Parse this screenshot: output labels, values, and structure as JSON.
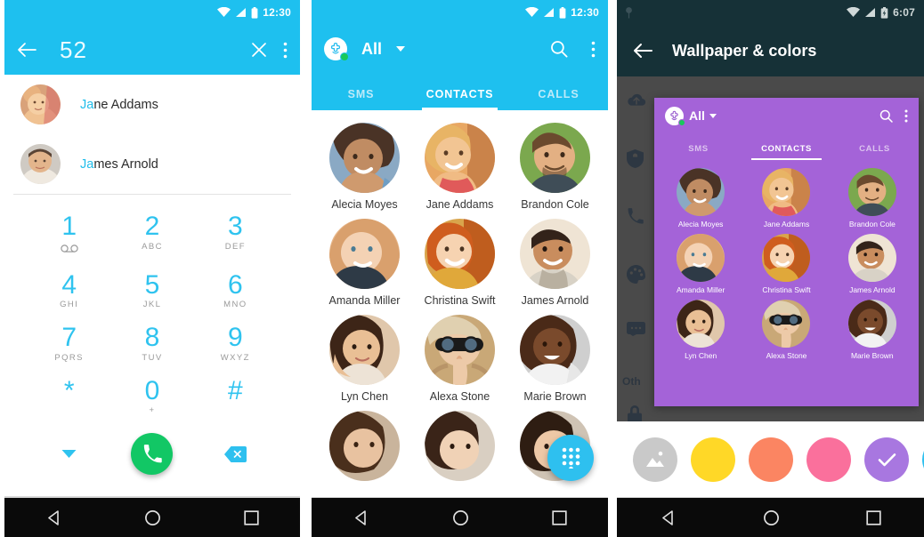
{
  "panels": {
    "dialer": {
      "statusbar": {
        "time": "12:30",
        "icons": [
          "wifi-icon",
          "signal-icon",
          "battery-icon"
        ]
      },
      "toolbar": {
        "back_icon": "back-arrow-icon",
        "number": "52",
        "clear_icon": "close-icon",
        "overflow_icon": "more-vert-icon"
      },
      "suggestions": [
        {
          "name_match": "Ja",
          "name_rest": "ne Addams"
        },
        {
          "name_match": "Ja",
          "name_rest": "mes Arnold"
        }
      ],
      "keypad": [
        [
          {
            "digit": "1",
            "sub": ""
          },
          {
            "digit": "2",
            "sub": "ABC"
          },
          {
            "digit": "3",
            "sub": "DEF"
          }
        ],
        [
          {
            "digit": "4",
            "sub": "GHI"
          },
          {
            "digit": "5",
            "sub": "JKL"
          },
          {
            "digit": "6",
            "sub": "MNO"
          }
        ],
        [
          {
            "digit": "7",
            "sub": "PQRS"
          },
          {
            "digit": "8",
            "sub": "TUV"
          },
          {
            "digit": "9",
            "sub": "WXYZ"
          }
        ],
        [
          {
            "digit": "*",
            "sub": ""
          },
          {
            "digit": "0",
            "sub": "+"
          },
          {
            "digit": "#",
            "sub": ""
          }
        ]
      ],
      "voicemail_icon": "voicemail-icon",
      "actions": {
        "collapse_icon": "chevron-down-icon",
        "call_icon": "phone-call-icon",
        "backspace_icon": "backspace-icon"
      },
      "colors": {
        "accent": "#1ec0ef",
        "call_green": "#12c765",
        "digit": "#2fc3ef"
      }
    },
    "contacts": {
      "statusbar": {
        "time": "12:30",
        "icons": [
          "wifi-icon",
          "signal-icon",
          "battery-icon"
        ]
      },
      "toolbar": {
        "app_icon": "app-logo-icon",
        "filter_label": "All",
        "search_icon": "search-icon",
        "overflow_icon": "more-vert-icon"
      },
      "tabs": [
        {
          "label": "SMS",
          "active": false
        },
        {
          "label": "CONTACTS",
          "active": true
        },
        {
          "label": "CALLS",
          "active": false
        }
      ],
      "grid": [
        [
          "Alecia Moyes",
          "Jane Addams",
          "Brandon Cole"
        ],
        [
          "Amanda Miller",
          "Christina Swift",
          "James Arnold"
        ],
        [
          "Lyn Chen",
          "Alexa Stone",
          "Marie Brown"
        ]
      ],
      "fab_icon": "dialpad-icon",
      "colors": {
        "accent": "#1ec0ef",
        "fab": "#2ec0ef"
      }
    },
    "wallpaper": {
      "statusbar": {
        "time": "6:07",
        "icons": [
          "notification-icon",
          "wifi-icon",
          "signal-icon",
          "battery-charging-icon"
        ]
      },
      "toolbar": {
        "back_icon": "back-arrow-icon",
        "title": "Wallpaper & colors"
      },
      "settings_behind": {
        "icons": [
          "cloud-upload-icon",
          "shield-icon",
          "phone-icon",
          "palette-icon",
          "chat-icon",
          "lock-icon"
        ],
        "section_label": "Oth"
      },
      "preview": {
        "toolbar": {
          "app_icon": "app-logo-icon",
          "filter_label": "All",
          "search_icon": "search-icon",
          "overflow_icon": "more-vert-icon"
        },
        "tabs": [
          {
            "label": "SMS",
            "active": false
          },
          {
            "label": "CONTACTS",
            "active": true
          },
          {
            "label": "CALLS",
            "active": false
          }
        ],
        "grid": [
          [
            "Alecia Moyes",
            "Jane Addams",
            "Brandon Cole"
          ],
          [
            "Amanda Miller",
            "Christina Swift",
            "James Arnold"
          ],
          [
            "Lyn Chen",
            "Alexa Stone",
            "Marie Brown"
          ]
        ],
        "theme_color": "#a463d8"
      },
      "swatches": [
        {
          "name": "image-wallpaper",
          "color": "#c9c9c9",
          "selected": false,
          "icon": "image-icon"
        },
        {
          "name": "yellow",
          "color": "#ffd827",
          "selected": false,
          "icon": ""
        },
        {
          "name": "orange",
          "color": "#fb8562",
          "selected": false,
          "icon": ""
        },
        {
          "name": "pink",
          "color": "#fa709c",
          "selected": false,
          "icon": ""
        },
        {
          "name": "purple",
          "color": "#a877e0",
          "selected": true,
          "icon": "check-icon"
        },
        {
          "name": "blue",
          "color": "#2ec0ef",
          "selected": false,
          "icon": ""
        }
      ],
      "colors": {
        "toolbar": "#163137",
        "backdrop": "#4a4a4a"
      }
    }
  },
  "navbar": {
    "back": "nav-back-icon",
    "home": "nav-home-icon",
    "recents": "nav-recents-icon"
  }
}
